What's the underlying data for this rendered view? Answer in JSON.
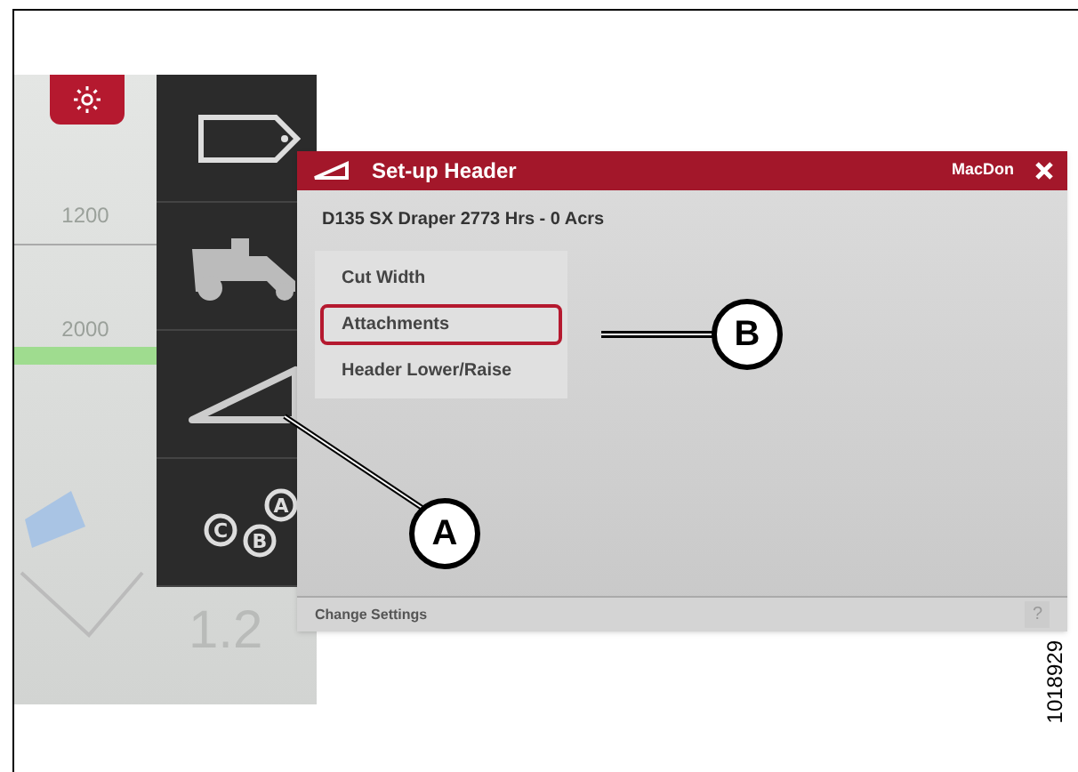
{
  "background_screen": {
    "readings": [
      "1200",
      "2000",
      "1.2"
    ]
  },
  "sidebar": {
    "items": [
      {
        "kind": "tag"
      },
      {
        "kind": "combine"
      },
      {
        "kind": "header"
      },
      {
        "kind": "abc",
        "letters": [
          "C",
          "A",
          "B"
        ]
      }
    ]
  },
  "dialog": {
    "title": "Set-up Header",
    "brand": "MacDon",
    "subtitle": "D135 SX Draper 2773 Hrs - 0 Acrs",
    "menu": [
      {
        "label": "Cut Width",
        "selected": false
      },
      {
        "label": "Attachments",
        "selected": true
      },
      {
        "label": "Header Lower/Raise",
        "selected": false
      }
    ],
    "footer": "Change Settings",
    "help": "?"
  },
  "callouts": [
    "A",
    "B"
  ],
  "figure_number": "1018929"
}
